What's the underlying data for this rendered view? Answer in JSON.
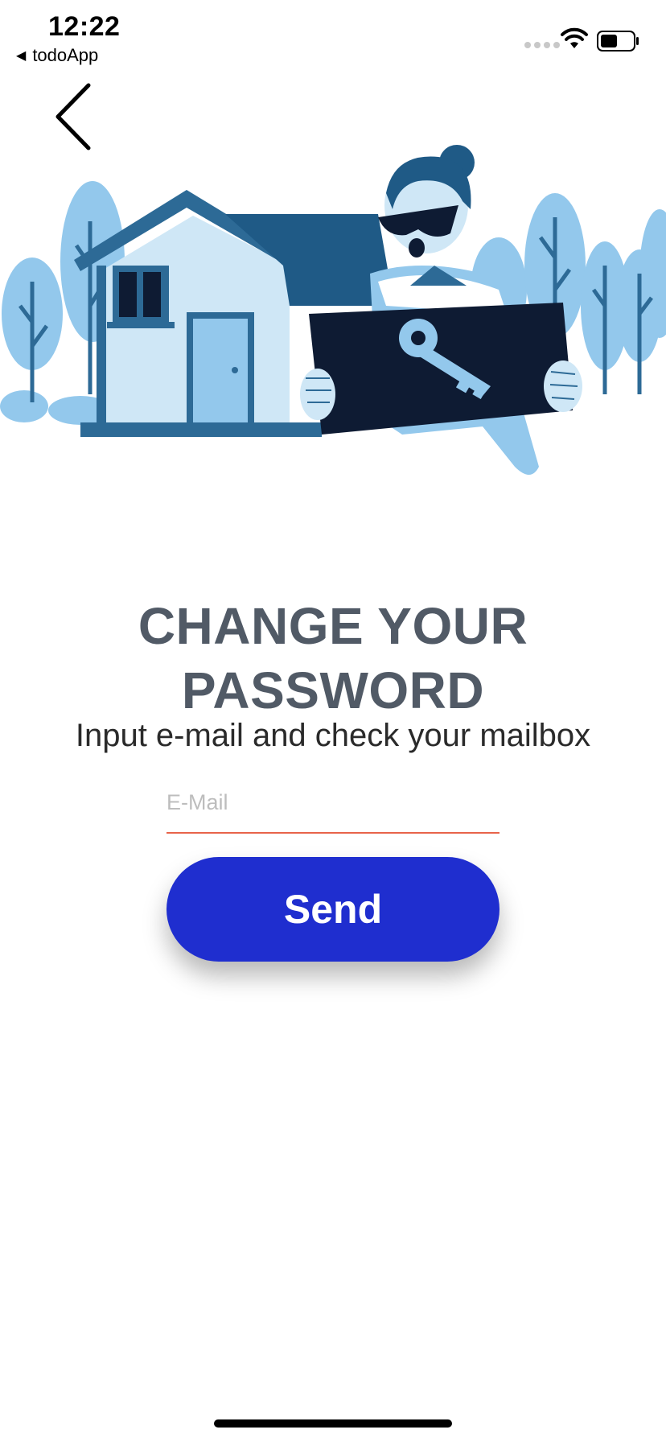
{
  "status_bar": {
    "time": "12:22",
    "back_app_label": "todoApp",
    "icons": [
      "signal-icon",
      "wifi-icon",
      "battery-icon"
    ]
  },
  "nav": {
    "back_icon": "chevron-left-icon"
  },
  "illustration": {
    "name": "woman-holding-key-sign-in-front-of-house"
  },
  "header": {
    "title_line1": "CHANGE YOUR",
    "title_line2": "PASSWORD",
    "subtitle": "Input e-mail and check your mailbox"
  },
  "form": {
    "email_placeholder": "E-Mail",
    "email_value": "",
    "send_label": "Send"
  },
  "colors": {
    "title": "#515a66",
    "button": "#1f2ecf",
    "input_underline": "#e8644a",
    "illustration_dark": "#0e1b33",
    "illustration_mid": "#2d6a96",
    "illustration_light": "#93c8ec"
  }
}
